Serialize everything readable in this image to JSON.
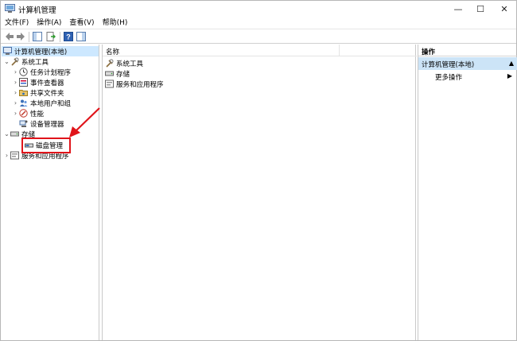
{
  "window": {
    "title": "计算机管理"
  },
  "controls": {
    "minimize": "—",
    "maximize": "☐",
    "close": "✕"
  },
  "menu": [
    "文件(F)",
    "操作(A)",
    "查看(V)",
    "帮助(H)"
  ],
  "tree": {
    "root": "计算机管理(本地)",
    "system_tools": "系统工具",
    "task_scheduler": "任务计划程序",
    "event_viewer": "事件查看器",
    "shared_folders": "共享文件夹",
    "local_users": "本地用户和组",
    "performance": "性能",
    "device_manager": "设备管理器",
    "storage": "存储",
    "disk_management": "磁盘管理",
    "services_apps": "服务和应用程序"
  },
  "main": {
    "column_name": "名称",
    "items": [
      "系统工具",
      "存储",
      "服务和应用程序"
    ]
  },
  "actions": {
    "header": "操作",
    "group": "计算机管理(本地)",
    "more": "更多操作"
  },
  "colors": {
    "selection": "#cde8ff",
    "annotation": "#e0141a"
  }
}
